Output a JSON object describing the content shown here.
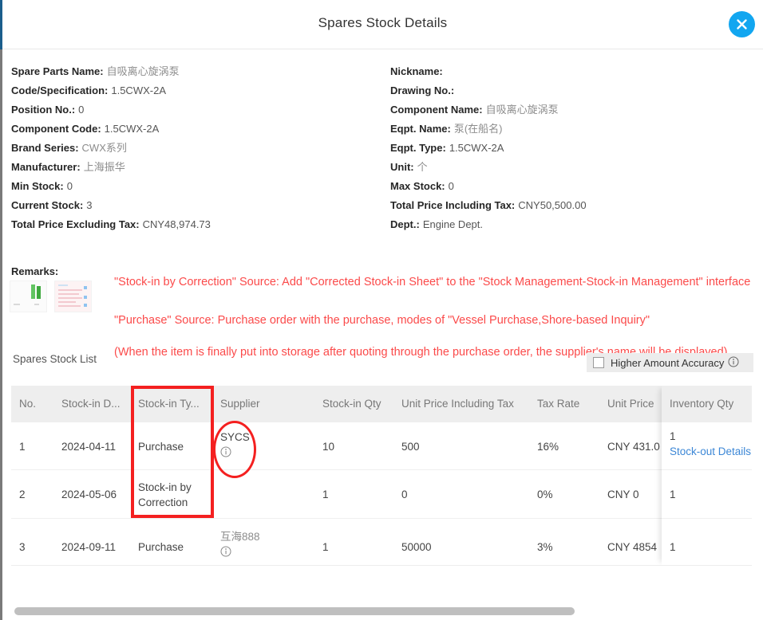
{
  "dialog": {
    "title": "Spares Stock Details",
    "close_label": "×"
  },
  "details": {
    "left": [
      {
        "label": "Spare Parts Name:",
        "value": "自吸离心旋涡泵",
        "cn": true
      },
      {
        "label": "Code/Specification:",
        "value": "1.5CWX-2A",
        "cn": false
      },
      {
        "label": "Position No.:",
        "value": "0",
        "cn": false
      },
      {
        "label": "Component Code:",
        "value": "1.5CWX-2A",
        "cn": false
      },
      {
        "label": "Brand Series:",
        "value": "CWX系列",
        "cn": true
      },
      {
        "label": "Manufacturer:",
        "value": "上海振华",
        "cn": true
      },
      {
        "label": "Min Stock:",
        "value": "0",
        "cn": false
      },
      {
        "label": "Current Stock:",
        "value": "3",
        "cn": false
      },
      {
        "label": "Total Price Excluding Tax:",
        "value": "CNY48,974.73",
        "cn": false
      }
    ],
    "right": [
      {
        "label": "Nickname:",
        "value": "",
        "cn": false
      },
      {
        "label": "Drawing No.:",
        "value": "",
        "cn": false
      },
      {
        "label": "Component Name:",
        "value": "自吸离心旋涡泵",
        "cn": true
      },
      {
        "label": "Eqpt. Name:",
        "value": "泵(在船名)",
        "cn": true
      },
      {
        "label": "Eqpt. Type:",
        "value": "1.5CWX-2A",
        "cn": false
      },
      {
        "label": "Unit:",
        "value": "个",
        "cn": true
      },
      {
        "label": "Max Stock:",
        "value": "0",
        "cn": false
      },
      {
        "label": "Total Price Including Tax:",
        "value": "CNY50,500.00",
        "cn": false
      },
      {
        "label": "Dept.:",
        "value": "Engine Dept.",
        "cn": false
      }
    ]
  },
  "remarks": {
    "label": "Remarks:"
  },
  "annotations": {
    "color": "#fb4a4a",
    "line1": "\"Stock-in by Correction\" Source: Add \"Corrected Stock-in Sheet\" to the \"Stock Management-Stock-in Management\" interface",
    "line2": "\"Purchase\" Source: Purchase order with the purchase, modes of \"Vessel Purchase,Shore-based Inquiry\"",
    "line3": "(When the item is finally put into storage after quoting through the purchase order, the supplier's name will be displayed)"
  },
  "list_section": {
    "title": "Spares Stock List",
    "accuracy_checkbox_label": "Higher Amount Accuracy",
    "accuracy_checked": false
  },
  "table": {
    "columns": [
      {
        "key": "no",
        "label": "No."
      },
      {
        "key": "date",
        "label": "Stock-in D..."
      },
      {
        "key": "type",
        "label": "Stock-in Ty..."
      },
      {
        "key": "supplier",
        "label": "Supplier"
      },
      {
        "key": "qty",
        "label": "Stock-in Qty"
      },
      {
        "key": "unit_price_incl",
        "label": "Unit Price Including Tax"
      },
      {
        "key": "tax_rate",
        "label": "Tax Rate"
      },
      {
        "key": "unit_price",
        "label": "Unit Price"
      }
    ],
    "fixed_column": {
      "key": "inventory_qty",
      "label": "Inventory Qty"
    },
    "rows": [
      {
        "no": "1",
        "date": "2024-04-11",
        "type": "Purchase",
        "supplier": "SYCS",
        "supplier_has_info": true,
        "supplier_cn": false,
        "qty": "10",
        "unit_price_incl": "500",
        "tax_rate": "16%",
        "unit_price": "CNY 431.0",
        "inventory_qty": "1",
        "inventory_link": "Stock-out Details"
      },
      {
        "no": "2",
        "date": "2024-05-06",
        "type": "Stock-in by Correction",
        "supplier": "",
        "supplier_has_info": false,
        "supplier_cn": false,
        "qty": "1",
        "unit_price_incl": "0",
        "tax_rate": "0%",
        "unit_price": "CNY 0",
        "inventory_qty": "1",
        "inventory_link": ""
      },
      {
        "no": "3",
        "date": "2024-09-11",
        "type": "Purchase",
        "supplier": "互海888",
        "supplier_has_info": true,
        "supplier_cn": true,
        "qty": "1",
        "unit_price_incl": "50000",
        "tax_rate": "3%",
        "unit_price": "CNY 4854",
        "inventory_qty": "1",
        "inventory_link": ""
      }
    ]
  },
  "markup": {
    "rect_color": "#f42020",
    "ellipse_color": "#f42020"
  }
}
